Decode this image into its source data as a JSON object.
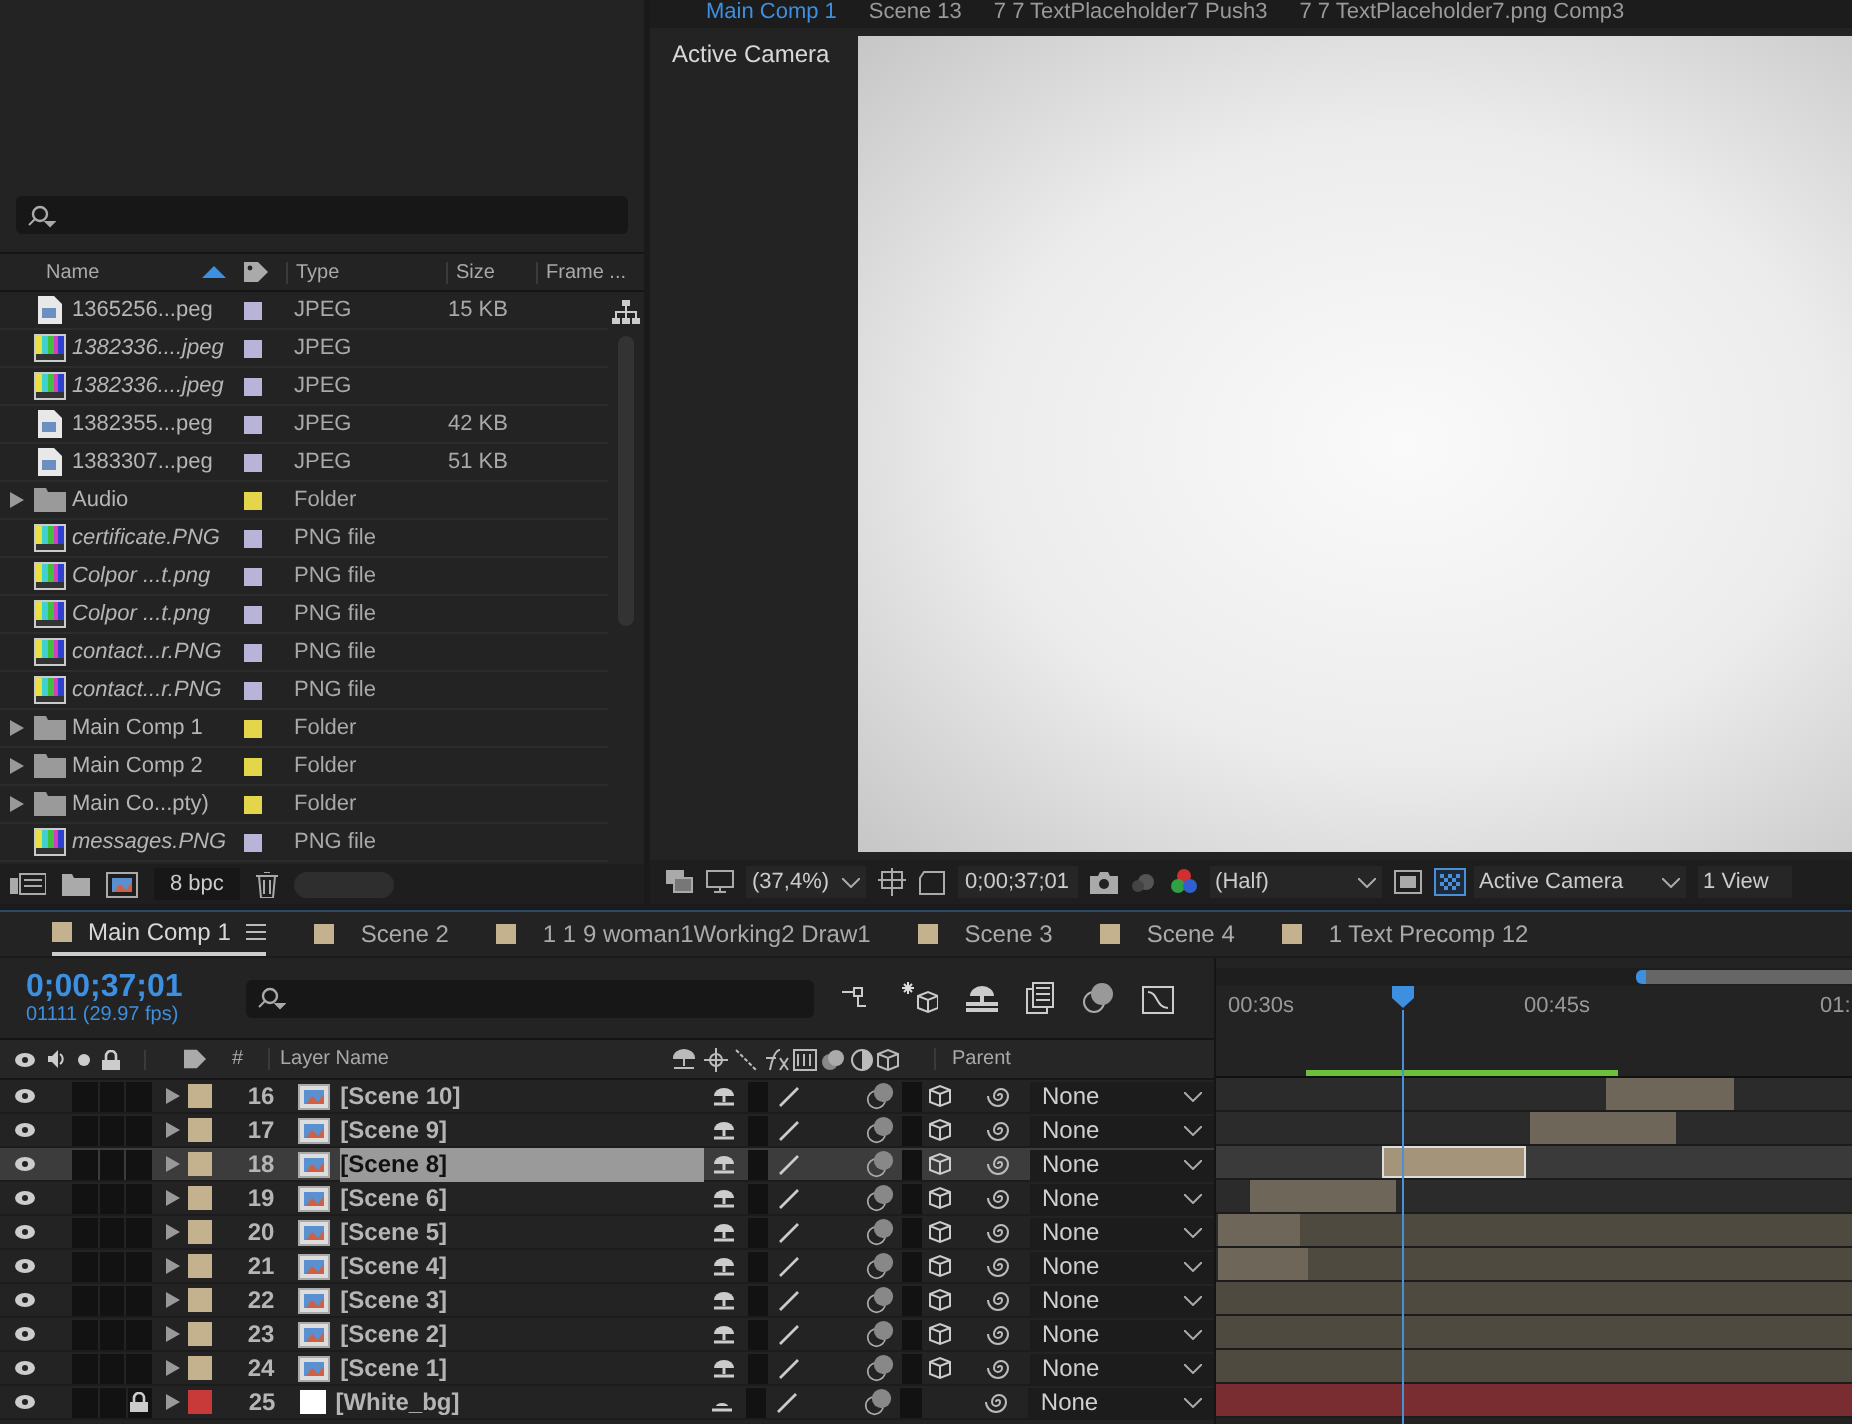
{
  "project": {
    "columns": [
      "Name",
      "Type",
      "Size",
      "Frame ..."
    ],
    "items": [
      {
        "kind": "file",
        "name": "1365256...peg",
        "missing": false,
        "color": "#b8b4d8",
        "type": "JPEG",
        "size": "15 KB"
      },
      {
        "kind": "image",
        "name": "1382336....jpeg",
        "missing": true,
        "color": "#b8b4d8",
        "type": "JPEG"
      },
      {
        "kind": "image",
        "name": "1382336....jpeg",
        "missing": true,
        "color": "#b8b4d8",
        "type": "JPEG"
      },
      {
        "kind": "file",
        "name": "1382355...peg",
        "missing": false,
        "color": "#b8b4d8",
        "type": "JPEG",
        "size": "42 KB"
      },
      {
        "kind": "file",
        "name": "1383307...peg",
        "missing": false,
        "color": "#b8b4d8",
        "type": "JPEG",
        "size": "51 KB"
      },
      {
        "kind": "folder",
        "name": "Audio",
        "missing": false,
        "color": "#e3d64a",
        "type": "Folder"
      },
      {
        "kind": "image",
        "name": "certificate.PNG",
        "missing": true,
        "color": "#b8b4d8",
        "type": "PNG file"
      },
      {
        "kind": "image",
        "name": "Colpor ...t.png",
        "missing": true,
        "color": "#b8b4d8",
        "type": "PNG file"
      },
      {
        "kind": "image",
        "name": "Colpor ...t.png",
        "missing": true,
        "color": "#b8b4d8",
        "type": "PNG file"
      },
      {
        "kind": "image",
        "name": "contact...r.PNG",
        "missing": true,
        "color": "#b8b4d8",
        "type": "PNG file"
      },
      {
        "kind": "image",
        "name": "contact...r.PNG",
        "missing": true,
        "color": "#b8b4d8",
        "type": "PNG file"
      },
      {
        "kind": "folder",
        "name": "Main Comp 1",
        "missing": false,
        "color": "#e3d64a",
        "type": "Folder"
      },
      {
        "kind": "folder",
        "name": "Main Comp 2",
        "missing": false,
        "color": "#e3d64a",
        "type": "Folder"
      },
      {
        "kind": "folder",
        "name": "Main Co...pty)",
        "missing": false,
        "color": "#e3d64a",
        "type": "Folder"
      },
      {
        "kind": "image",
        "name": "messages.PNG",
        "missing": true,
        "color": "#b8b4d8",
        "type": "PNG file"
      }
    ],
    "bit_depth": "8 bpc"
  },
  "viewer": {
    "tabs": [
      {
        "label": "Main Comp 1",
        "selected": true
      },
      {
        "label": "Scene 13",
        "selected": false
      },
      {
        "label": "7 7 TextPlaceholder7 Push3",
        "selected": false
      },
      {
        "label": "7 7 TextPlaceholder7.png Comp3",
        "selected": false
      }
    ],
    "camera_label": "Active Camera",
    "toolbar": {
      "zoom": "(37,4%)",
      "timecode": "0;00;37;01",
      "resolution": "(Half)",
      "camera": "Active Camera",
      "views": "1 View"
    }
  },
  "timeline": {
    "tabs": [
      {
        "label": "Main Comp 1",
        "selected": true,
        "color": "#c4b18e"
      },
      {
        "label": "Scene 2",
        "selected": false,
        "color": "#c4b18e"
      },
      {
        "label": "1 1 9 woman1Working2 Draw1",
        "selected": false,
        "color": "#c4b18e"
      },
      {
        "label": "Scene 3",
        "selected": false,
        "color": "#c4b18e"
      },
      {
        "label": "Scene 4",
        "selected": false,
        "color": "#c4b18e"
      },
      {
        "label": "1 Text Precomp 12",
        "selected": false,
        "color": "#c4b18e"
      }
    ],
    "timecode": "0;00;37;01",
    "frames": "01111 (29.97 fps)",
    "columns": {
      "number": "#",
      "layer_name": "Layer Name",
      "parent": "Parent"
    },
    "ruler": [
      "00:30s",
      "00:45s",
      "01:"
    ],
    "layers": [
      {
        "number": "16",
        "name": "[Scene 10]",
        "kind": "comp",
        "color": "#c4b18e",
        "locked": false,
        "selected": false,
        "parent": "None"
      },
      {
        "number": "17",
        "name": "[Scene 9]",
        "kind": "comp",
        "color": "#c4b18e",
        "locked": false,
        "selected": false,
        "parent": "None"
      },
      {
        "number": "18",
        "name": "[Scene 8]",
        "kind": "comp",
        "color": "#c4b18e",
        "locked": false,
        "selected": true,
        "parent": "None"
      },
      {
        "number": "19",
        "name": "[Scene 6]",
        "kind": "comp",
        "color": "#c4b18e",
        "locked": false,
        "selected": false,
        "parent": "None"
      },
      {
        "number": "20",
        "name": "[Scene 5]",
        "kind": "comp",
        "color": "#c4b18e",
        "locked": false,
        "selected": false,
        "parent": "None"
      },
      {
        "number": "21",
        "name": "[Scene 4]",
        "kind": "comp",
        "color": "#c4b18e",
        "locked": false,
        "selected": false,
        "parent": "None"
      },
      {
        "number": "22",
        "name": "[Scene 3]",
        "kind": "comp",
        "color": "#c4b18e",
        "locked": false,
        "selected": false,
        "parent": "None"
      },
      {
        "number": "23",
        "name": "[Scene 2]",
        "kind": "comp",
        "color": "#c4b18e",
        "locked": false,
        "selected": false,
        "parent": "None"
      },
      {
        "number": "24",
        "name": "[Scene 1]",
        "kind": "comp",
        "color": "#c4b18e",
        "locked": false,
        "selected": false,
        "parent": "None"
      },
      {
        "number": "25",
        "name": "[White_bg]",
        "kind": "solid",
        "color": "#c83a3a",
        "locked": true,
        "selected": false,
        "parent": "None"
      }
    ]
  }
}
